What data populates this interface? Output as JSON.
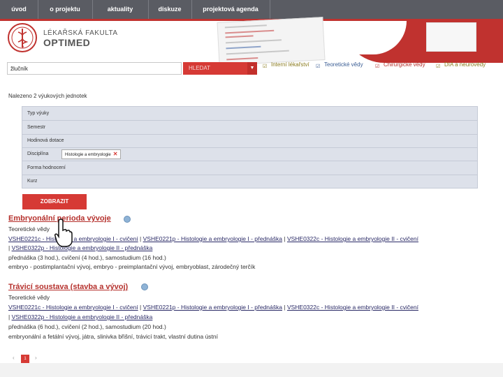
{
  "nav": {
    "items": [
      "úvod",
      "o projektu",
      "aktuality",
      "diskuze",
      "projektová agenda"
    ]
  },
  "brand": {
    "line1": "LÉKAŘSKÁ FAKULTA",
    "line2": "OPTIMED"
  },
  "search": {
    "value": "žlučník",
    "select_label": "HLEDAT"
  },
  "categories": [
    {
      "label": "Interní lékařství",
      "color": "#8a7a1d"
    },
    {
      "label": "Teoretické vědy",
      "color": "#3a5d94"
    },
    {
      "label": "Chirurgické vědy",
      "color": "#b5302c"
    },
    {
      "label": "DIA a neurovědy",
      "color": "#8a7a1d"
    }
  ],
  "found_text": "Nalezeno 2 výukových jednotek",
  "filters": {
    "rows": [
      "Typ výuky",
      "Semestr",
      "Hodinová dotace",
      "Disciplína",
      "Forma hodnocení",
      "Kurz"
    ],
    "discipline_chip": "Histologie a embryologie"
  },
  "show_button": "ZOBRAZIT",
  "results": [
    {
      "title": "Embryonální perioda vývoje",
      "category": "Teoretické vědy",
      "links_line1": [
        "VSHE0221c - Histologie a embryologie I - cvičení",
        "VSHE0221p - Histologie a embryologie I - přednáška",
        "VSHE0322c - Histologie a embryologie II - cvičení"
      ],
      "links_line2": [
        "VSHE0322p - Histologie a embryologie II - přednáška"
      ],
      "hours": "přednáška (3 hod.), cvičení (4 hod.), samostudium (16 hod.)",
      "keywords": "embryo - postimplantační vývoj, embryo - preimplantační vývoj, embryoblast, zárodečný terčík"
    },
    {
      "title": "Trávicí soustava (stavba a vývoj)",
      "category": "Teoretické vědy",
      "links_line1": [
        "VSHE0221c - Histologie a embryologie I - cvičení",
        "VSHE0221p - Histologie a embryologie I - přednáška",
        "VSHE0322c - Histologie a embryologie II - cvičení"
      ],
      "links_line2": [
        "VSHE0322p - Histologie a embryologie II - přednáška"
      ],
      "hours": "přednáška (6 hod.), cvičení (2 hod.), samostudium (20 hod.)",
      "keywords": "embryonální a fetální vývoj, játra, slinivka břišní, trávicí trakt, vlastní dutina ústní"
    }
  ],
  "pager": {
    "current": "1",
    "prev": "‹",
    "next": "›"
  },
  "colors": {
    "accent": "#c0322f",
    "nav_bg": "#5a5c63",
    "filter_bg": "#dde1ea"
  },
  "icons": {
    "logo": "caduceus-seal-icon",
    "cursor": "hand-pointer-icon",
    "result_marker": "blue-dot-icon",
    "check": "checkbox-check-icon"
  }
}
